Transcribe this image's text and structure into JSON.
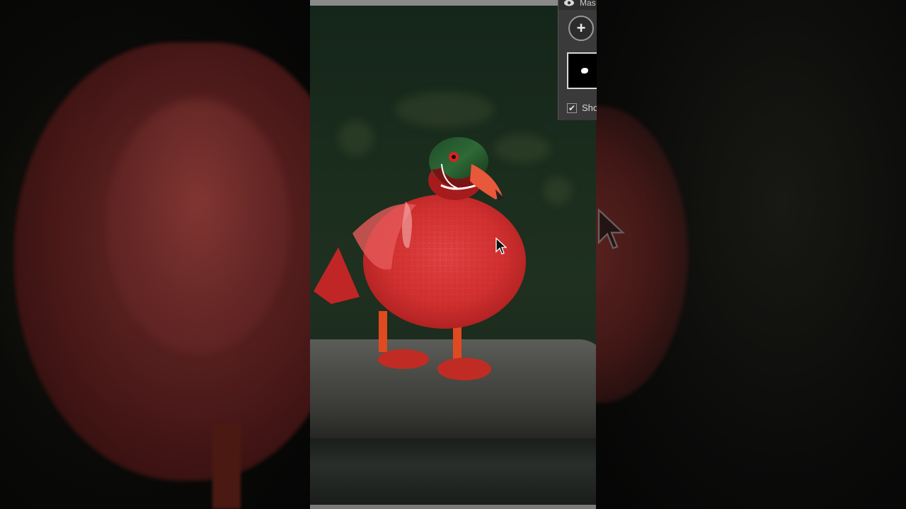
{
  "mask_panel": {
    "title": "Mas",
    "add_label": "+",
    "show_label": "Sho",
    "show_checked": "✔"
  },
  "colors": {
    "duck_body": "#d83232",
    "panel_bg": "#3a3a3a",
    "background": "#000000"
  },
  "icons": [
    "eye-icon",
    "plus-icon",
    "cursor-icon",
    "checkbox-icon"
  ]
}
